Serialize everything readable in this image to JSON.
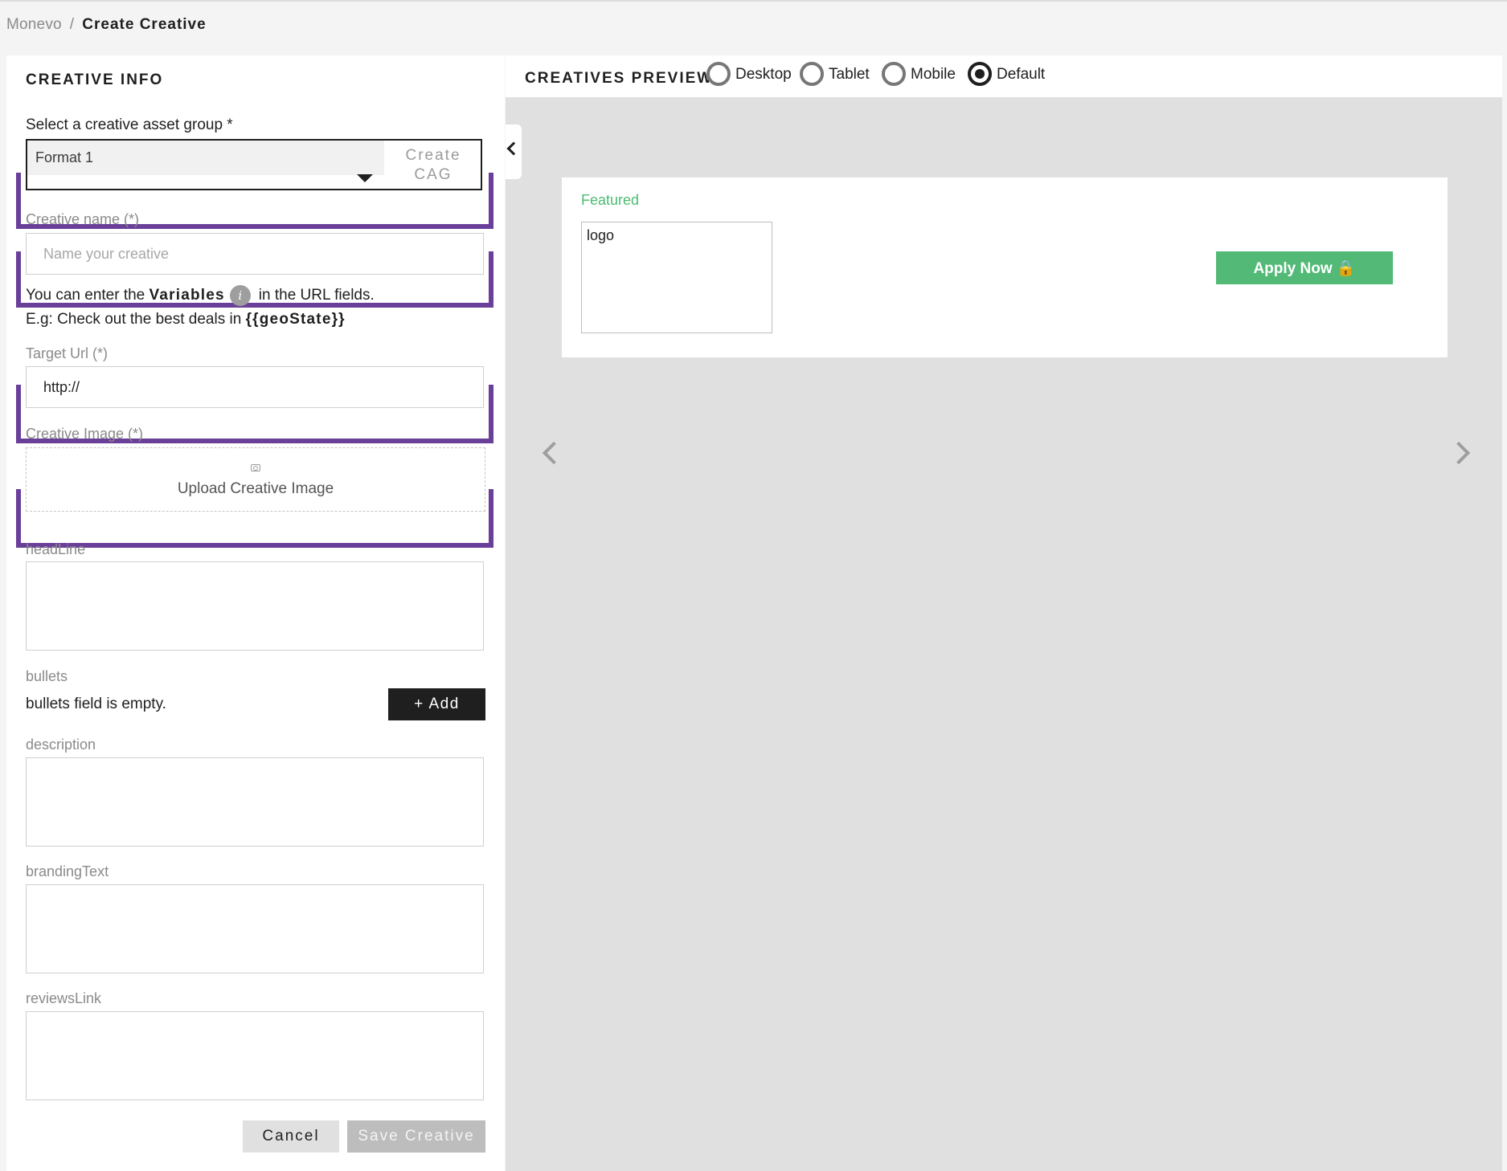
{
  "breadcrumb": {
    "root": "Monevo",
    "separator": "/",
    "current": "Create Creative"
  },
  "creative_info": {
    "title": "CREATIVE INFO",
    "asset_group": {
      "label": "Select a creative asset group *",
      "selected": "Format 1",
      "create_button": "Create CAG"
    },
    "creative_name": {
      "label": "Creative name (*)",
      "placeholder": "Name your creative",
      "value": ""
    },
    "variables_hint": {
      "prefix": "You can enter the",
      "keyword": "Variables",
      "suffix": "in the URL fields.",
      "example_prefix": "E.g: Check out the best deals in",
      "example_variable": "{{geoState}}"
    },
    "target_url": {
      "label": "Target Url (*)",
      "value": "http://"
    },
    "creative_image": {
      "label": "Creative Image (*)",
      "upload_label": "Upload Creative Image"
    },
    "headline": {
      "label": "headLine"
    },
    "bullets": {
      "label": "bullets",
      "empty_text": "bullets field is empty.",
      "add_button": "+ Add"
    },
    "description": {
      "label": "description"
    },
    "branding_text": {
      "label": "brandingText"
    },
    "reviews_link": {
      "label": "reviewsLink"
    },
    "actions": {
      "cancel": "Cancel",
      "save": "Save Creative"
    }
  },
  "preview": {
    "title": "CREATIVES PREVIEW",
    "devices": [
      {
        "label": "Desktop",
        "checked": false
      },
      {
        "label": "Tablet",
        "checked": false
      },
      {
        "label": "Mobile",
        "checked": false
      },
      {
        "label": "Default",
        "checked": true
      }
    ],
    "card": {
      "featured": "Featured",
      "logo": "logo",
      "apply_button": "Apply Now 🔒"
    }
  },
  "colors": {
    "highlight_bracket": "#6a3f9a",
    "featured_green": "#4dbb72",
    "apply_green": "#52b977",
    "add_button_bg": "#1f1f1f",
    "save_disabled_bg": "#bdbdbd"
  },
  "icons": [
    "info-icon",
    "camera-icon",
    "chevron-down-icon",
    "chevron-left-icon",
    "chevron-right-icon",
    "lock-icon"
  ]
}
